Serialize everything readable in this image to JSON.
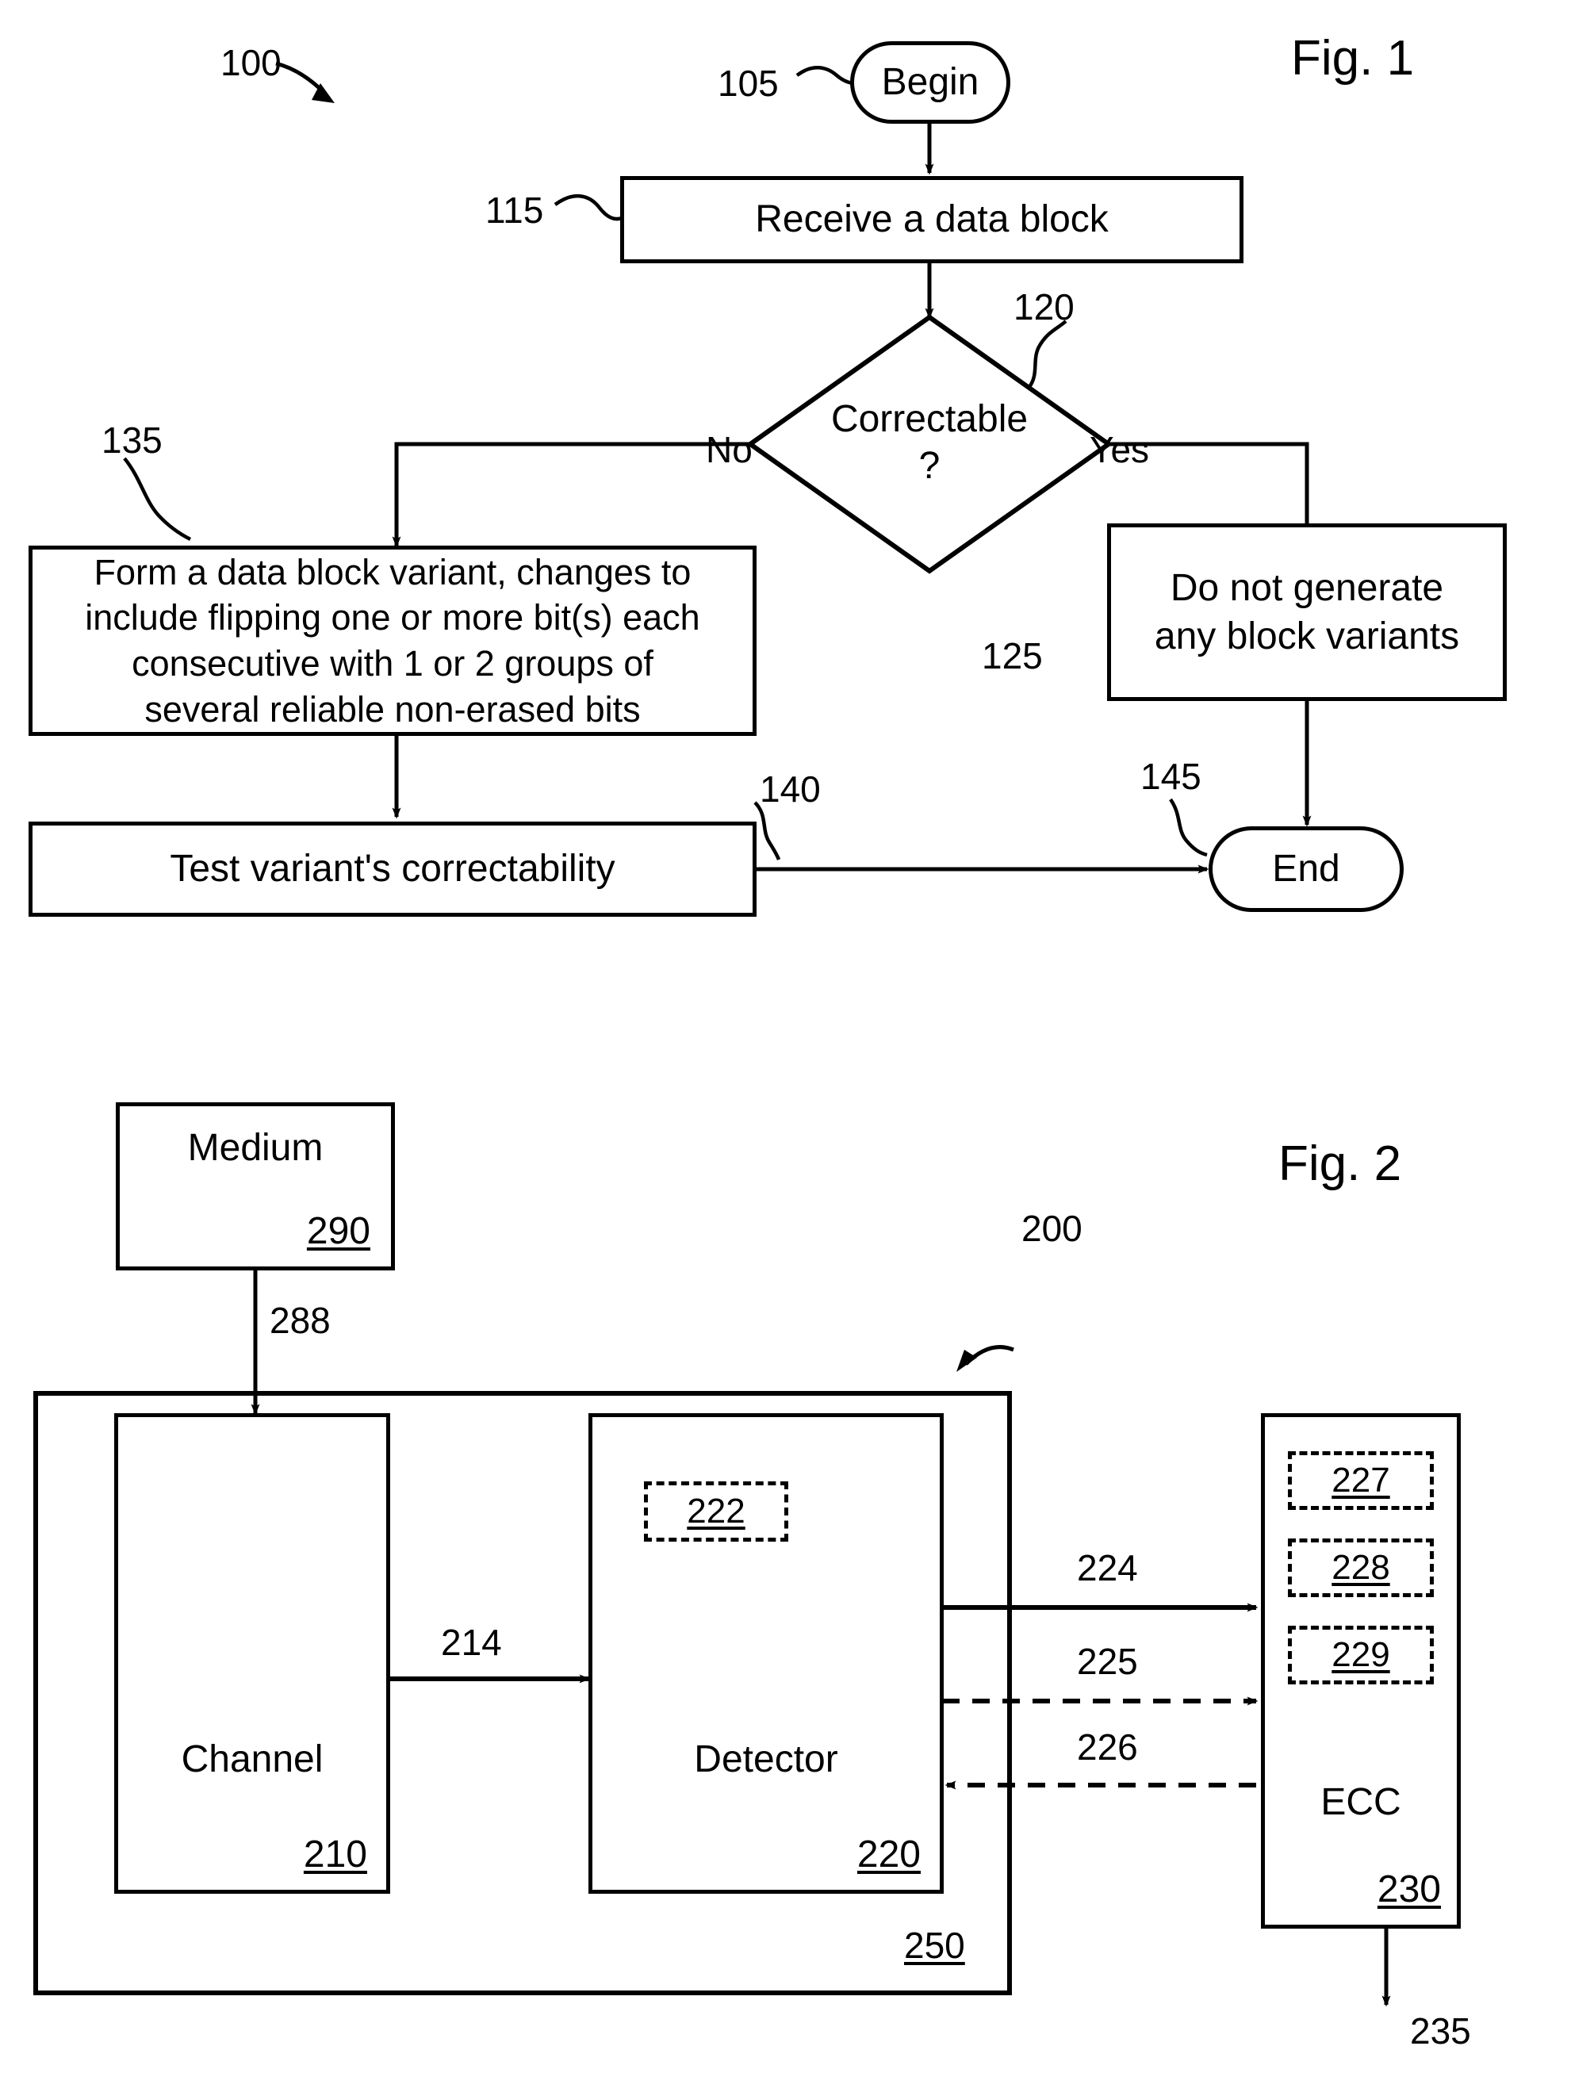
{
  "figures": [
    {
      "id": "fig1",
      "title": "Fig. 1",
      "ref": "100",
      "nodes": {
        "begin": {
          "label": "Begin",
          "ref": "105"
        },
        "receive": {
          "label": "Receive a data block",
          "ref": "115"
        },
        "decision": {
          "label_line1": "Correctable",
          "label_line2": "?",
          "ref": "120"
        },
        "no_label": "No",
        "yes_label": "Yes",
        "form_variant": {
          "line1": "Form a data block variant, changes to",
          "line2": "include flipping one or more bit(s) each",
          "line3": "consecutive with 1 or 2 groups of",
          "line4": "several reliable non-erased bits",
          "ref": "135"
        },
        "no_generate": {
          "line1": "Do not generate",
          "line2": "any block variants",
          "ref": "125"
        },
        "test_variant": {
          "label": "Test variant's correctability",
          "ref": "140"
        },
        "end": {
          "label": "End",
          "ref": "145"
        }
      }
    },
    {
      "id": "fig2",
      "title": "Fig. 2",
      "ref": "200",
      "nodes": {
        "medium": {
          "label": "Medium",
          "ref": "290"
        },
        "medium_link_ref": "288",
        "system": {
          "ref": "250"
        },
        "channel": {
          "label": "Channel",
          "ref": "210"
        },
        "detector": {
          "label": "Detector",
          "ref": "220",
          "inner_ref": "222"
        },
        "ecc": {
          "label": "ECC",
          "ref": "230",
          "inner_refs": [
            "227",
            "228",
            "229"
          ]
        },
        "channel_to_detector_ref": "214",
        "detector_to_ecc_solid_ref": "224",
        "detector_to_ecc_dashed_ref": "225",
        "ecc_to_detector_dashed_ref": "226",
        "ecc_output_ref": "235"
      }
    }
  ],
  "colors": {
    "ink": "#000000",
    "paper": "#ffffff"
  }
}
